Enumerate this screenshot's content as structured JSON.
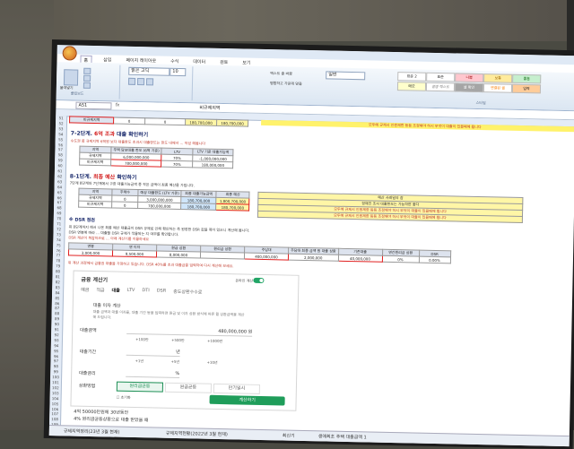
{
  "ribbon": {
    "tabs": [
      "홈",
      "삽입",
      "페이지 레이아웃",
      "수식",
      "데이터",
      "검토",
      "보기"
    ],
    "font_name": "맑은 고딕",
    "font_size": "10",
    "clipboard_label": "클립보드",
    "paste_label": "붙여넣기",
    "wrap_label": "텍스트 줄 바꿈",
    "merge_label": "병합하고 가운데 맞춤",
    "number_format": "일반",
    "styles": [
      "표준 2",
      "표준",
      "나쁨",
      "보통",
      "좋음",
      "메모",
      "설명 텍스트",
      "셀 확인",
      "연결된 셀",
      "입력"
    ],
    "cond_label": "스타일"
  },
  "formula_bar": {
    "name_box": "A51",
    "fx": "fx",
    "content": "비규제지역"
  },
  "rows": [
    "51",
    "52",
    "53",
    "54",
    "55",
    "56",
    "57",
    "58",
    "59",
    "60",
    "61",
    "62",
    "63",
    "64",
    "65",
    "66",
    "67",
    "68",
    "69",
    "70",
    "71",
    "72",
    "73",
    "74",
    "75",
    "76",
    "77",
    "78",
    "79",
    "80",
    "81",
    "82",
    "83",
    "84",
    "85",
    "86",
    "87",
    "88",
    "89",
    "90",
    "91",
    "92",
    "93",
    "94",
    "95",
    "96",
    "97",
    "98",
    "99",
    "100",
    "101",
    "102",
    "103",
    "104",
    "105",
    "106",
    "107",
    "108",
    "109",
    "110"
  ],
  "row51": {
    "label": "비규제지역",
    "v1": "0",
    "v2": "0",
    "v3": "180,700,000",
    "v4": "180,700,000"
  },
  "yellow_note": "모두에 규제시 인원제한 등등 조정해야 하시 무엇이 대출이 있을때에 됩니다",
  "section7": {
    "title_prefix": "7-2단계.",
    "title_red": "6억 조과",
    "title_suffix": "대출 확인하기",
    "note": "수도권 중 규제지역 6억원 보다 대출한도 초과시 대출한도는 한도 내에서 ... 작성 해봅니다",
    "headers": [
      "지역",
      "주택 담보대출 한도 (6억 기준)",
      "LTV",
      "LTV 기준 대출가능액"
    ],
    "rows": [
      [
        "규제지역",
        "6,000,000,000",
        "70%",
        "-1,000,000,000"
      ],
      [
        "비규제지역",
        "780,000,000",
        "70%",
        "180,000,000"
      ]
    ]
  },
  "section8": {
    "title_prefix": "8-1단계.",
    "title_red": "최종 예산",
    "title_suffix": "확인하기",
    "note": "7단계 8단계와 7단계에서 구한 대출가능금액 중 작은 금액이 최종 예산을 가집니다.",
    "headers": [
      "지역",
      "주택수",
      "예상 대출한도 (LTV 기준)",
      "최종 대출가능금액",
      "최종 예산"
    ],
    "rows": [
      [
        "규제지역",
        "0",
        "3,000,000,000",
        "180,700,000",
        "1,800,700,000"
      ],
      [
        "비규제지역",
        "0",
        "780,000,000",
        "180,700,000",
        "180,700,000"
      ]
    ],
    "right_notes": [
      "예산 사례일의 참",
      "정해진 조사 대출한도는 가능하면 좋다",
      "모두에 규제시 인원제한 등등 조정해야 하시 무엇이 대출이 있을때에 됩니다",
      "모두에 규제시 인원제한 등등 조정해야 하시 무엇이 대출이 있을때에 됩니다"
    ]
  },
  "dsr": {
    "title": "※ DSR 점검",
    "notes": [
      "위 8단계까지 해서 나온 최종 예산 대출금이 DSR 규제로 인해 확인하는 즉 원정한 DSR 값을 쪽이 있으니 계산해 봅니다.",
      "DSR 연봉에 따라 ... 대출할 DSR 규제가 적용되는 지 여부를 확인합니다.",
      "DSR 계산이 복잡하므로 ... 아래 계산기를 이용하세요"
    ],
    "headers": [
      "연봉",
      "연 이자",
      "원금 상환",
      "원리금 상환",
      "주담대",
      "주담대 최종 금액 원 대출 상환",
      "기존대출",
      "연간원리금 상환",
      "DSR"
    ],
    "values": [
      "3,000,000",
      "9,500,000",
      "8,000,000",
      "",
      "400,000,000",
      "2,000,000",
      "40,000,000",
      "0%",
      "0.00%"
    ],
    "note2": "위 계산 과정에서 금융권 대출을 가정하고 있습니다. DSR 40%를 초과 대출금을 입력하여 다시 계산해 보세요."
  },
  "calculator": {
    "title": "금융 계산기",
    "toggle_label": "온라인 계산",
    "tabs": [
      "예금",
      "적금",
      "대출",
      "LTV",
      "DTI",
      "DSR",
      "중도상환수수료"
    ],
    "active_tab": "대출",
    "subtitle": "대출 이자 계산",
    "desc": "대출 금액과 대출 이자율, 대출 기간 등을 입력하면 원금 및 이자 상환 방식에 따른 월 상환금액을 계산해 드립니다.",
    "amount_label": "대출금액",
    "amount_value": "480,000,000 원",
    "amount_chips": [
      "+100만",
      "+500만",
      "+1000만"
    ],
    "period_label": "대출기간",
    "period_value": "년",
    "period_chips": [
      "+1년",
      "+5년",
      "+10년"
    ],
    "rate_label": "대출금리",
    "rate_value": "%",
    "method_label": "상환방법",
    "methods": [
      "원리금균등",
      "원금균등",
      "만기일시"
    ],
    "active_method": "원리금균등",
    "checkbox_label": "초기화",
    "calc_button": "계산하기"
  },
  "bottom_notes": [
    "4억 50000만원에 30년동안",
    "4% 원리금균등상환으로 대출 받았을 때"
  ],
  "sheet_tabs": [
    "규제지역정리(23년 3월 현재)",
    "규제지역현황(2022년 3월 현재)",
    "최신기",
    "생애최초 주택 대출금액 1"
  ]
}
